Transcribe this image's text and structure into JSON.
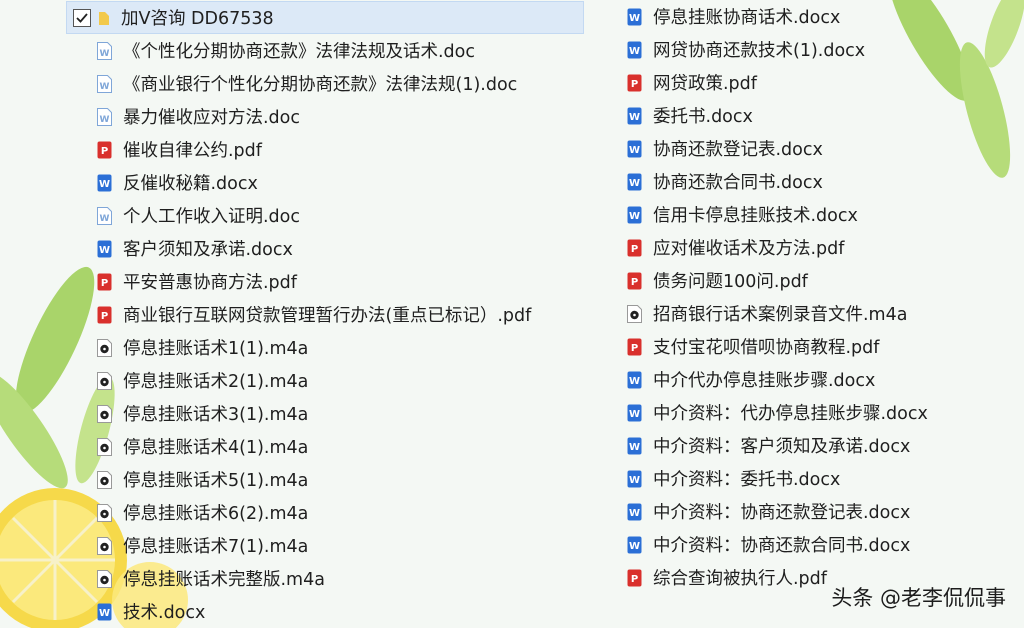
{
  "header": {
    "checked": true,
    "folder_title": "加V咨询  DD67538"
  },
  "left_files": [
    {
      "name": "《个性化分期协商还款》法律法规及话术.doc",
      "type": "doc"
    },
    {
      "name": "《商业银行个性化分期协商还款》法律法规(1).doc",
      "type": "doc"
    },
    {
      "name": "暴力催收应对方法.doc",
      "type": "doc"
    },
    {
      "name": "催收自律公约.pdf",
      "type": "pdf"
    },
    {
      "name": "反催收秘籍.docx",
      "type": "docx"
    },
    {
      "name": "个人工作收入证明.doc",
      "type": "doc"
    },
    {
      "name": "客户须知及承诺.docx",
      "type": "docx"
    },
    {
      "name": "平安普惠协商方法.pdf",
      "type": "pdf"
    },
    {
      "name": "商业银行互联网贷款管理暂行办法(重点已标记）.pdf",
      "type": "pdf"
    },
    {
      "name": "停息挂账话术1(1).m4a",
      "type": "m4a"
    },
    {
      "name": "停息挂账话术2(1).m4a",
      "type": "m4a"
    },
    {
      "name": "停息挂账话术3(1).m4a",
      "type": "m4a"
    },
    {
      "name": "停息挂账话术4(1).m4a",
      "type": "m4a"
    },
    {
      "name": "停息挂账话术5(1).m4a",
      "type": "m4a"
    },
    {
      "name": "停息挂账话术6(2).m4a",
      "type": "m4a"
    },
    {
      "name": "停息挂账话术7(1).m4a",
      "type": "m4a"
    },
    {
      "name": "停息挂账话术完整版.m4a",
      "type": "m4a"
    },
    {
      "name": "技术.docx",
      "type": "docx"
    }
  ],
  "right_files": [
    {
      "name": "停息挂账协商话术.docx",
      "type": "docx"
    },
    {
      "name": "网贷协商还款技术(1).docx",
      "type": "docx"
    },
    {
      "name": "网贷政策.pdf",
      "type": "pdf"
    },
    {
      "name": "委托书.docx",
      "type": "docx"
    },
    {
      "name": "协商还款登记表.docx",
      "type": "docx"
    },
    {
      "name": "协商还款合同书.docx",
      "type": "docx"
    },
    {
      "name": "信用卡停息挂账技术.docx",
      "type": "docx"
    },
    {
      "name": "应对催收话术及方法.pdf",
      "type": "pdf"
    },
    {
      "name": "债务问题100问.pdf",
      "type": "pdf"
    },
    {
      "name": "招商银行话术案例录音文件.m4a",
      "type": "m4a"
    },
    {
      "name": "支付宝花呗借呗协商教程.pdf",
      "type": "pdf"
    },
    {
      "name": "中介代办停息挂账步骤.docx",
      "type": "docx"
    },
    {
      "name": "中介资料：代办停息挂账步骤.docx",
      "type": "docx"
    },
    {
      "name": "中介资料：客户须知及承诺.docx",
      "type": "docx"
    },
    {
      "name": "中介资料：委托书.docx",
      "type": "docx"
    },
    {
      "name": "中介资料：协商还款登记表.docx",
      "type": "docx"
    },
    {
      "name": "中介资料：协商还款合同书.docx",
      "type": "docx"
    },
    {
      "name": "综合查询被执行人.pdf",
      "type": "pdf"
    }
  ],
  "watermark": "头条 @老李侃侃事",
  "colors": {
    "pdf": "#d9302c",
    "docx": "#2b6fd6",
    "doc": "#7fa6d8",
    "m4a": "#222222",
    "selection": "#dce9f7"
  }
}
